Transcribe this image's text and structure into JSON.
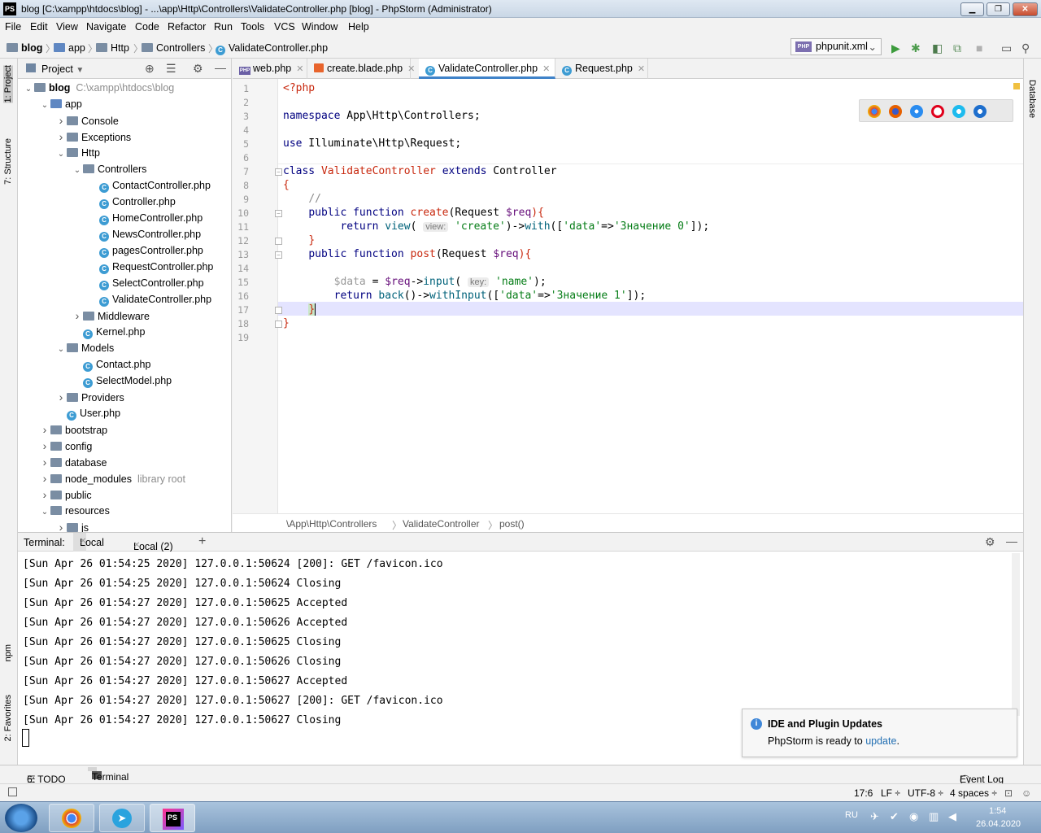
{
  "window": {
    "title": "blog [C:\\xampp\\htdocs\\blog] - ...\\app\\Http\\Controllers\\ValidateController.php [blog] - PhpStorm (Administrator)",
    "app_badge": "PS"
  },
  "menu": [
    "File",
    "Edit",
    "View",
    "Navigate",
    "Code",
    "Refactor",
    "Run",
    "Tools",
    "VCS",
    "Window",
    "Help"
  ],
  "navbar": {
    "crumbs": [
      "blog",
      "app",
      "Http",
      "Controllers",
      "ValidateController.php"
    ],
    "run_config": "phpunit.xml",
    "run_config_badge": "PHP"
  },
  "left_strip": {
    "project": "1: Project",
    "structure": "7: Structure",
    "npm": "npm",
    "favorites": "2: Favorites"
  },
  "right_strip": {
    "database": "Database"
  },
  "project": {
    "header": "Project",
    "tree": [
      {
        "label": "blog",
        "extra": "C:\\xampp\\htdocs\\blog",
        "depth": 0,
        "type": "folder",
        "open": true,
        "bold": true
      },
      {
        "label": "app",
        "depth": 1,
        "type": "folder",
        "open": true
      },
      {
        "label": "Console",
        "depth": 2,
        "type": "folder",
        "open": false
      },
      {
        "label": "Exceptions",
        "depth": 2,
        "type": "folder",
        "open": false
      },
      {
        "label": "Http",
        "depth": 2,
        "type": "folder",
        "open": true
      },
      {
        "label": "Controllers",
        "depth": 3,
        "type": "folder",
        "open": true
      },
      {
        "label": "ContactController.php",
        "depth": 4,
        "type": "class"
      },
      {
        "label": "Controller.php",
        "depth": 4,
        "type": "class"
      },
      {
        "label": "HomeController.php",
        "depth": 4,
        "type": "class"
      },
      {
        "label": "NewsController.php",
        "depth": 4,
        "type": "class"
      },
      {
        "label": "pagesController.php",
        "depth": 4,
        "type": "class"
      },
      {
        "label": "RequestController.php",
        "depth": 4,
        "type": "class"
      },
      {
        "label": "SelectController.php",
        "depth": 4,
        "type": "class"
      },
      {
        "label": "ValidateController.php",
        "depth": 4,
        "type": "class"
      },
      {
        "label": "Middleware",
        "depth": 3,
        "type": "folder",
        "open": false
      },
      {
        "label": "Kernel.php",
        "depth": 3,
        "type": "class"
      },
      {
        "label": "Models",
        "depth": 2,
        "type": "folder",
        "open": true
      },
      {
        "label": "Contact.php",
        "depth": 3,
        "type": "class"
      },
      {
        "label": "SelectModel.php",
        "depth": 3,
        "type": "class"
      },
      {
        "label": "Providers",
        "depth": 2,
        "type": "folder",
        "open": false
      },
      {
        "label": "User.php",
        "depth": 2,
        "type": "class"
      },
      {
        "label": "bootstrap",
        "depth": 1,
        "type": "folder",
        "open": false
      },
      {
        "label": "config",
        "depth": 1,
        "type": "folder",
        "open": false
      },
      {
        "label": "database",
        "depth": 1,
        "type": "folder",
        "open": false
      },
      {
        "label": "node_modules",
        "extra": "library root",
        "depth": 1,
        "type": "folder",
        "open": false
      },
      {
        "label": "public",
        "depth": 1,
        "type": "folder",
        "open": false
      },
      {
        "label": "resources",
        "depth": 1,
        "type": "folder",
        "open": true
      },
      {
        "label": "js",
        "depth": 2,
        "type": "folder",
        "open": false
      }
    ]
  },
  "editor_tabs": [
    {
      "label": "web.php",
      "kind": "php",
      "active": false
    },
    {
      "label": "create.blade.php",
      "kind": "blade",
      "active": false
    },
    {
      "label": "ValidateController.php",
      "kind": "class",
      "active": true
    },
    {
      "label": "Request.php",
      "kind": "class",
      "active": false
    }
  ],
  "code": {
    "line_numbers": [
      "1",
      "2",
      "3",
      "4",
      "5",
      "6",
      "7",
      "8",
      "9",
      "10",
      "11",
      "12",
      "13",
      "14",
      "15",
      "16",
      "17",
      "18",
      "19"
    ],
    "l1": "<?php",
    "l3_kw": "namespace",
    "l3_rest": " App\\Http\\Controllers;",
    "l5_kw": "use",
    "l5_rest": " Illuminate\\Http\\Request;",
    "l7_kw1": "class",
    "l7_name": " ValidateController ",
    "l7_kw2": "extends",
    "l7_rest": " Controller",
    "l8": "{",
    "l9": "//",
    "l10_kw": "public function",
    "l10_fn": " create",
    "l10_a": "(Request ",
    "l10_var": "$req",
    "l10_b": "){",
    "l11_kw": "return",
    "l11_fn": " view",
    "l11_a": "( ",
    "l11_hint": "view:",
    "l11_str1": " 'create'",
    "l11_b": ")->",
    "l11_fn2": "with",
    "l11_c": "([",
    "l11_str2": "'data'",
    "l11_d": "=>",
    "l11_str3": "'Значение 0'",
    "l11_e": "]);",
    "l12": "}",
    "l13_kw": "public function",
    "l13_fn": " post",
    "l13_a": "(Request ",
    "l13_var": "$req",
    "l13_b": "){",
    "l15_var": "$data",
    "l15_a": " = ",
    "l15_var2": "$req",
    "l15_b": "->",
    "l15_fn": "input",
    "l15_c": "( ",
    "l15_hint": "key:",
    "l15_str": " 'name'",
    "l15_d": ");",
    "l16_kw": "return",
    "l16_fn": " back",
    "l16_a": "()->",
    "l16_fn2": "withInput",
    "l16_b": "([",
    "l16_str1": "'data'",
    "l16_c": "=>",
    "l16_str2": "'Значение 1'",
    "l16_d": "]);",
    "l17": "}",
    "l18": "}"
  },
  "editor_breadcrumb": [
    "\\App\\Http\\Controllers",
    "ValidateController",
    "post()"
  ],
  "terminal": {
    "label": "Terminal:",
    "tabs": [
      "Local",
      "Local (2)"
    ],
    "lines": [
      "[Sun Apr 26 01:54:25 2020] 127.0.0.1:50624 [200]: GET /favicon.ico",
      "[Sun Apr 26 01:54:25 2020] 127.0.0.1:50624 Closing",
      "[Sun Apr 26 01:54:27 2020] 127.0.0.1:50625 Accepted",
      "[Sun Apr 26 01:54:27 2020] 127.0.0.1:50626 Accepted",
      "[Sun Apr 26 01:54:27 2020] 127.0.0.1:50625 Closing",
      "[Sun Apr 26 01:54:27 2020] 127.0.0.1:50626 Closing",
      "[Sun Apr 26 01:54:27 2020] 127.0.0.1:50627 Accepted",
      "[Sun Apr 26 01:54:27 2020] 127.0.0.1:50627 [200]: GET /favicon.ico",
      "[Sun Apr 26 01:54:27 2020] 127.0.0.1:50627 Closing"
    ]
  },
  "notification": {
    "title": "IDE and Plugin Updates",
    "body_prefix": "PhpStorm is ready to ",
    "link": "update",
    "body_suffix": "."
  },
  "bottom_tools": {
    "todo": "6: TODO",
    "terminal": "Terminal",
    "event_log": "Event Log"
  },
  "statusbar": {
    "position": "17:6",
    "line_sep": "LF ÷",
    "encoding": "UTF-8 ÷",
    "indent": "4 spaces ÷"
  },
  "taskbar": {
    "lang": "RU",
    "time": "1:54",
    "date": "26.04.2020",
    "ps_badge": "PS"
  },
  "colors": {
    "accent": "#4083c9",
    "keyword": "#000080",
    "string": "#067d17",
    "variable": "#660e7a",
    "function": "#00627a"
  }
}
